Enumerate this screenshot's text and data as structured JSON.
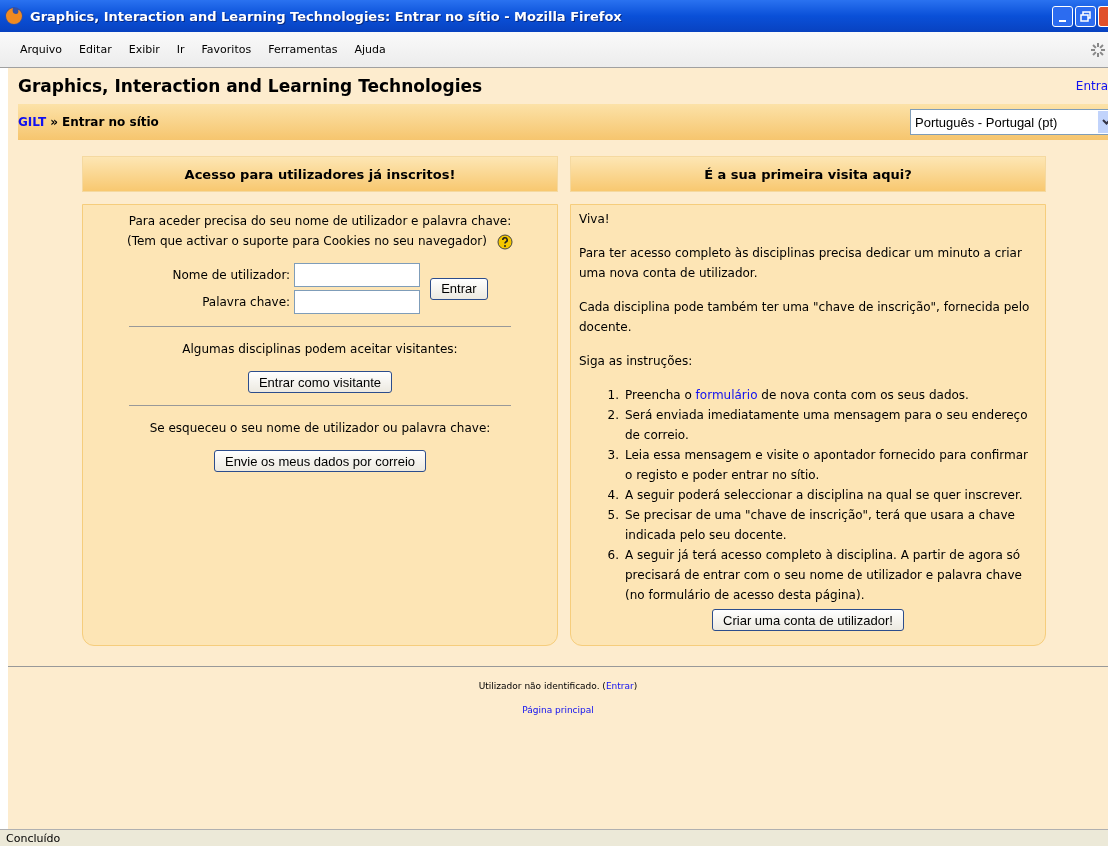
{
  "window": {
    "title": "Graphics, Interaction and Learning Technologies: Entrar no sítio - Mozilla Firefox"
  },
  "menu": [
    "Arquivo",
    "Editar",
    "Exibir",
    "Ir",
    "Favoritos",
    "Ferramentas",
    "Ajuda"
  ],
  "header": {
    "title": "Graphics, Interaction and Learning Technologies",
    "login_link": "Entra"
  },
  "breadcrumb": {
    "home": "GILT",
    "separator": "»",
    "current": "Entrar no sítio"
  },
  "language_select": {
    "value": "Português - Portugal (pt)"
  },
  "login_panel": {
    "heading": "Acesso para utilizadores já inscritos!",
    "intro": "Para aceder precisa do seu nome de utilizador e palavra chave:",
    "cookies_note": "(Tem que activar o suporte para Cookies no seu navegador)",
    "username_label": "Nome de utilizador:",
    "password_label": "Palavra chave:",
    "login_button": "Entrar",
    "guest_text": "Algumas disciplinas podem aceitar visitantes:",
    "guest_button": "Entrar como visitante",
    "forgot_text": "Se esqueceu o seu nome de utilizador ou palavra chave:",
    "forgot_button": "Envie os meus dados por correio"
  },
  "signup_panel": {
    "heading": "É a sua primeira visita aqui?",
    "paragraphs": [
      "Viva!",
      "Para ter acesso completo às disciplinas precisa dedicar um minuto a criar uma nova conta de utilizador.",
      "Cada disciplina pode também ter uma \"chave de inscrição\", fornecida pelo docente.",
      "Siga as instruções:"
    ],
    "steps": [
      {
        "marker": "1.",
        "before": "Preencha o ",
        "link": "formulário",
        "after": " de nova conta com os seus dados."
      },
      {
        "marker": "2.",
        "before": "Será enviada imediatamente uma mensagem para o seu endereço de correio."
      },
      {
        "marker": "3.",
        "before": "Leia essa mensagem e visite o apontador fornecido para confirmar o registo e poder entrar no sítio."
      },
      {
        "marker": "4.",
        "before": "A seguir poderá seleccionar a disciplina na qual se quer inscrever."
      },
      {
        "marker": "5.",
        "before": "Se precisar de uma \"chave de inscrição\", terá que usara a chave indicada pelo seu docente."
      },
      {
        "marker": "6.",
        "before": "A seguir já terá acesso completo à disciplina. A partir de agora só precisará de entrar com o seu nome de utilizador e palavra chave (no formulário de acesso desta página)."
      }
    ],
    "signup_button": "Criar uma conta de utilizador!"
  },
  "footer": {
    "status_text": "Utilizador não identificado. (",
    "login_link": "Entrar",
    "status_end": ")",
    "home_link": "Página principal"
  },
  "status_bar": {
    "text": "Concluído"
  }
}
